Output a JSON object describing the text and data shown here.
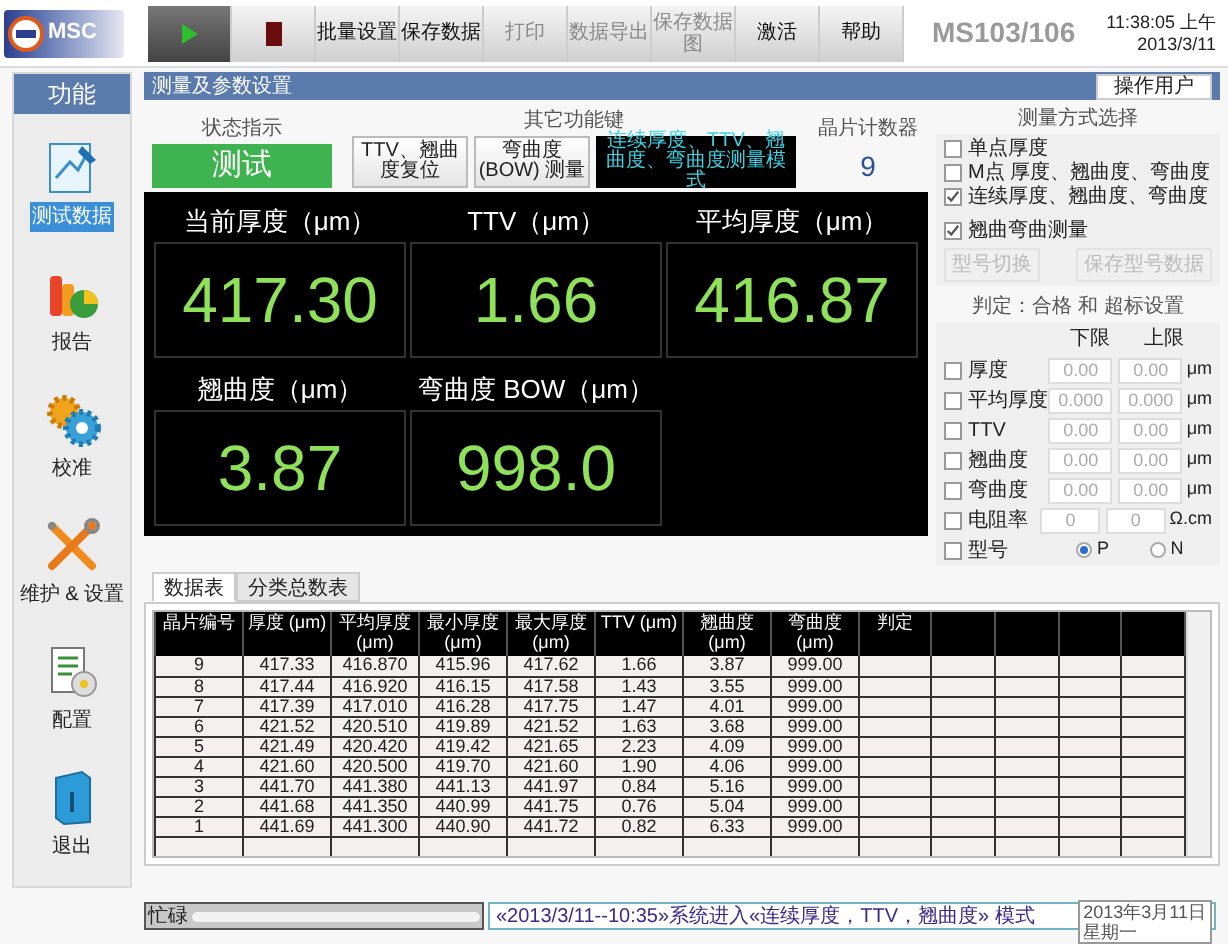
{
  "logo": {
    "text": "MSC"
  },
  "toolbar": [
    {
      "kind": "play",
      "disabled": false
    },
    {
      "kind": "stop",
      "disabled": false
    },
    {
      "kind": "text",
      "label": "批量设置",
      "disabled": false
    },
    {
      "kind": "text",
      "label": "保存数据",
      "disabled": false
    },
    {
      "kind": "text",
      "label": "打印",
      "disabled": true
    },
    {
      "kind": "text",
      "label": "数据导出",
      "disabled": true
    },
    {
      "kind": "text",
      "label": "保存数据图",
      "disabled": true
    },
    {
      "kind": "text",
      "label": "激活",
      "disabled": false
    },
    {
      "kind": "text",
      "label": "帮助",
      "disabled": false
    }
  ],
  "model": "MS103/106",
  "clock": {
    "time": "11:38:05 上午",
    "date": "2013/3/11"
  },
  "sidebar": {
    "title": "功能",
    "items": [
      {
        "kind": "test",
        "label": "测试数据",
        "selected": true
      },
      {
        "kind": "report",
        "label": "报告",
        "selected": false
      },
      {
        "kind": "calibrate",
        "label": "校准",
        "selected": false
      },
      {
        "kind": "tools",
        "label": "维护 & 设置",
        "selected": false
      },
      {
        "kind": "config",
        "label": "配置",
        "selected": false
      },
      {
        "kind": "exit",
        "label": "退出",
        "selected": false
      }
    ]
  },
  "panel": {
    "title": "测量及参数设置",
    "user_button": "操作用户",
    "status": {
      "caption": "状态指示",
      "value": "测试"
    },
    "functions": {
      "caption": "其它功能键",
      "buttons": [
        "TTV、翘曲度复位",
        "弯曲度 (BOW) 测量"
      ],
      "mode": "连续厚度、TTV、翘曲度、弯曲度测量模式"
    },
    "counter": {
      "caption": "晶片计数器",
      "value": "9"
    },
    "metrics": [
      {
        "label": "当前厚度（μm）",
        "value": "417.30"
      },
      {
        "label": "TTV（μm）",
        "value": "1.66"
      },
      {
        "label": "平均厚度（μm）",
        "value": "416.87"
      },
      {
        "label": "翘曲度（μm）",
        "value": "3.87"
      },
      {
        "label": "弯曲度 BOW（μm）",
        "value": "998.0"
      }
    ],
    "mode_select": {
      "caption": "测量方式选择",
      "options": [
        {
          "label": "单点厚度",
          "checked": false
        },
        {
          "label": "M点 厚度、翘曲度、弯曲度",
          "checked": false
        },
        {
          "label": "连续厚度、翘曲度、弯曲度",
          "checked": true
        }
      ],
      "warp_bow": {
        "label": "翘曲弯曲测量",
        "checked": true
      },
      "buttons": [
        "型号切换",
        "保存型号数据"
      ]
    },
    "limits": {
      "caption": "判定：合格 和 超标设置",
      "lower": "下限",
      "upper": "上限",
      "rows": [
        {
          "label": "厚度",
          "checked": false,
          "low": "0.00",
          "high": "0.00",
          "unit": "μm"
        },
        {
          "label": "平均厚度",
          "checked": false,
          "low": "0.000",
          "high": "0.000",
          "unit": "μm"
        },
        {
          "label": "TTV",
          "checked": false,
          "low": "0.00",
          "high": "0.00",
          "unit": "μm"
        },
        {
          "label": "翘曲度",
          "checked": false,
          "low": "0.00",
          "high": "0.00",
          "unit": "μm"
        },
        {
          "label": "弯曲度",
          "checked": false,
          "low": "0.00",
          "high": "0.00",
          "unit": "μm"
        },
        {
          "label": "电阻率",
          "checked": false,
          "low": "0",
          "high": "0",
          "unit": "Ω.cm"
        }
      ],
      "type_row": {
        "label": "型号",
        "checked": false,
        "options": [
          {
            "label": "P",
            "selected": true
          },
          {
            "label": "N",
            "selected": false
          }
        ]
      }
    }
  },
  "tabs": [
    {
      "label": "数据表",
      "selected": true
    },
    {
      "label": "分类总数表",
      "selected": false
    }
  ],
  "table": {
    "columns": [
      "晶片编号",
      "厚度 (μm)",
      "平均厚度 (μm)",
      "最小厚度 (μm)",
      "最大厚度 (μm)",
      "TTV (μm)",
      "翘曲度 (μm)",
      "弯曲度 (μm)",
      "判定"
    ],
    "rows": [
      [
        "9",
        "417.33",
        "416.870",
        "415.96",
        "417.62",
        "1.66",
        "3.87",
        "999.00"
      ],
      [
        "8",
        "417.44",
        "416.920",
        "416.15",
        "417.58",
        "1.43",
        "3.55",
        "999.00"
      ],
      [
        "7",
        "417.39",
        "417.010",
        "416.28",
        "417.75",
        "1.47",
        "4.01",
        "999.00"
      ],
      [
        "6",
        "421.52",
        "420.510",
        "419.89",
        "421.52",
        "1.63",
        "3.68",
        "999.00"
      ],
      [
        "5",
        "421.49",
        "420.420",
        "419.42",
        "421.65",
        "2.23",
        "4.09",
        "999.00"
      ],
      [
        "4",
        "421.60",
        "420.500",
        "419.70",
        "421.60",
        "1.90",
        "4.06",
        "999.00"
      ],
      [
        "3",
        "441.70",
        "441.380",
        "441.13",
        "441.97",
        "0.84",
        "5.16",
        "999.00"
      ],
      [
        "2",
        "441.68",
        "441.350",
        "440.99",
        "441.75",
        "0.76",
        "5.04",
        "999.00"
      ],
      [
        "1",
        "441.69",
        "441.300",
        "440.90",
        "441.72",
        "0.82",
        "6.33",
        "999.00"
      ]
    ]
  },
  "status_bar": {
    "busy_label": "忙碌",
    "level": 1,
    "log": "«2013/3/11--10:35»系统进入«连续厚度，TTV，翘曲度» 模式",
    "tooltip": [
      "2013年3月11日",
      "星期一"
    ]
  }
}
